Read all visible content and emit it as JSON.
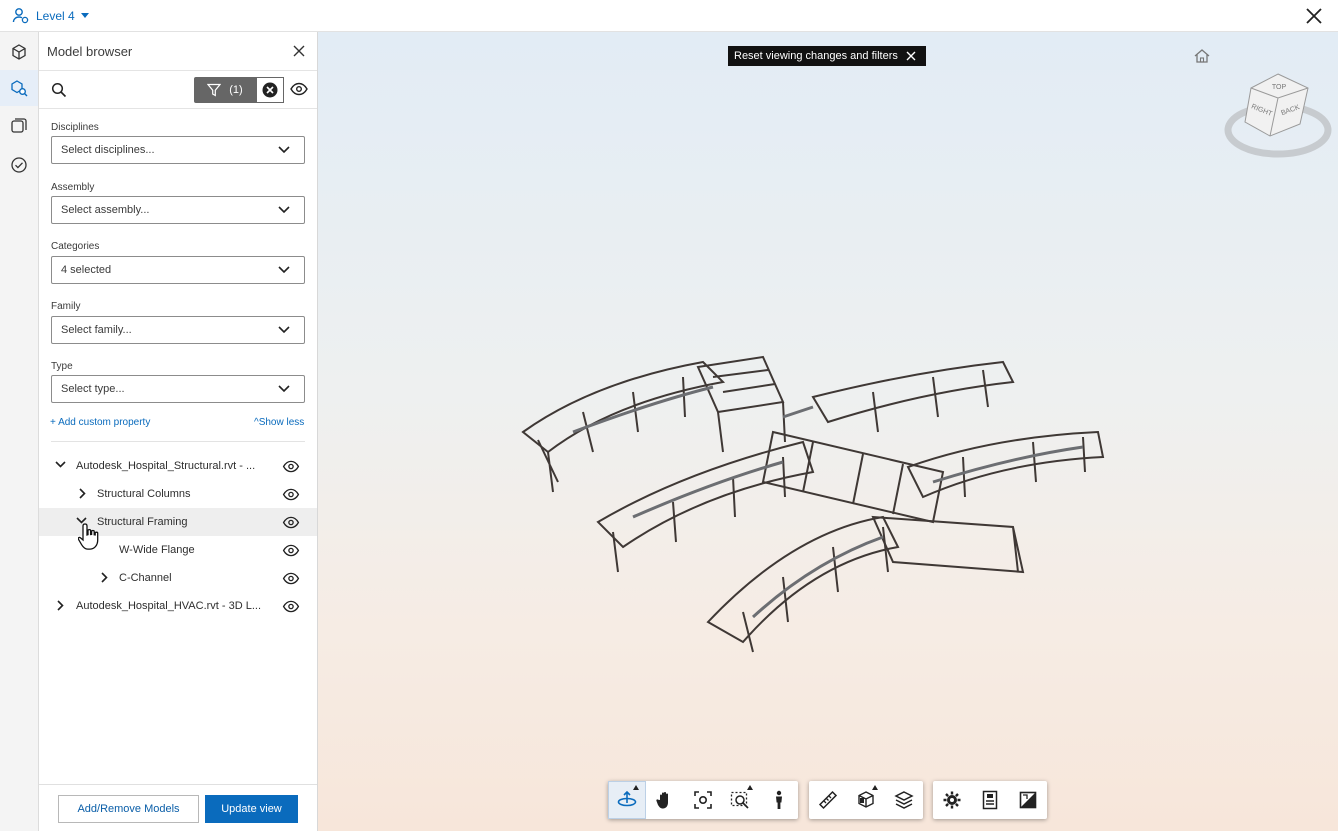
{
  "topbar": {
    "level_label": "Level 4"
  },
  "panel": {
    "title": "Model browser",
    "filter_count": "(1)",
    "fields": [
      {
        "label": "Disciplines",
        "value": "Select disciplines..."
      },
      {
        "label": "Assembly",
        "value": "Select assembly..."
      },
      {
        "label": "Categories",
        "value": "4 selected"
      },
      {
        "label": "Family",
        "value": "Select family..."
      },
      {
        "label": "Type",
        "value": "Select type..."
      }
    ],
    "add_custom": "+ Add custom property",
    "show_less": "^Show less",
    "tree": [
      {
        "label": "Autodesk_Hospital_Structural.rvt - ...",
        "expanded": true
      },
      {
        "label": "Structural Columns",
        "expanded": false
      },
      {
        "label": "Structural Framing",
        "expanded": true,
        "hovered": true
      },
      {
        "label": "W-Wide Flange",
        "expanded": false
      },
      {
        "label": "C-Channel",
        "expanded": false
      },
      {
        "label": "Autodesk_Hospital_HVAC.rvt - 3D L...",
        "expanded": false
      }
    ],
    "footer": {
      "add_remove": "Add/Remove Models",
      "update_view": "Update view"
    }
  },
  "viewport": {
    "reset_label": "Reset viewing changes and filters",
    "viewcube": {
      "top": "TOP",
      "right": "RIGHT",
      "back": "BACK"
    }
  },
  "colors": {
    "accent": "#0a6bbd",
    "filter_bg": "#666666",
    "model_steel": "#3f3835"
  }
}
